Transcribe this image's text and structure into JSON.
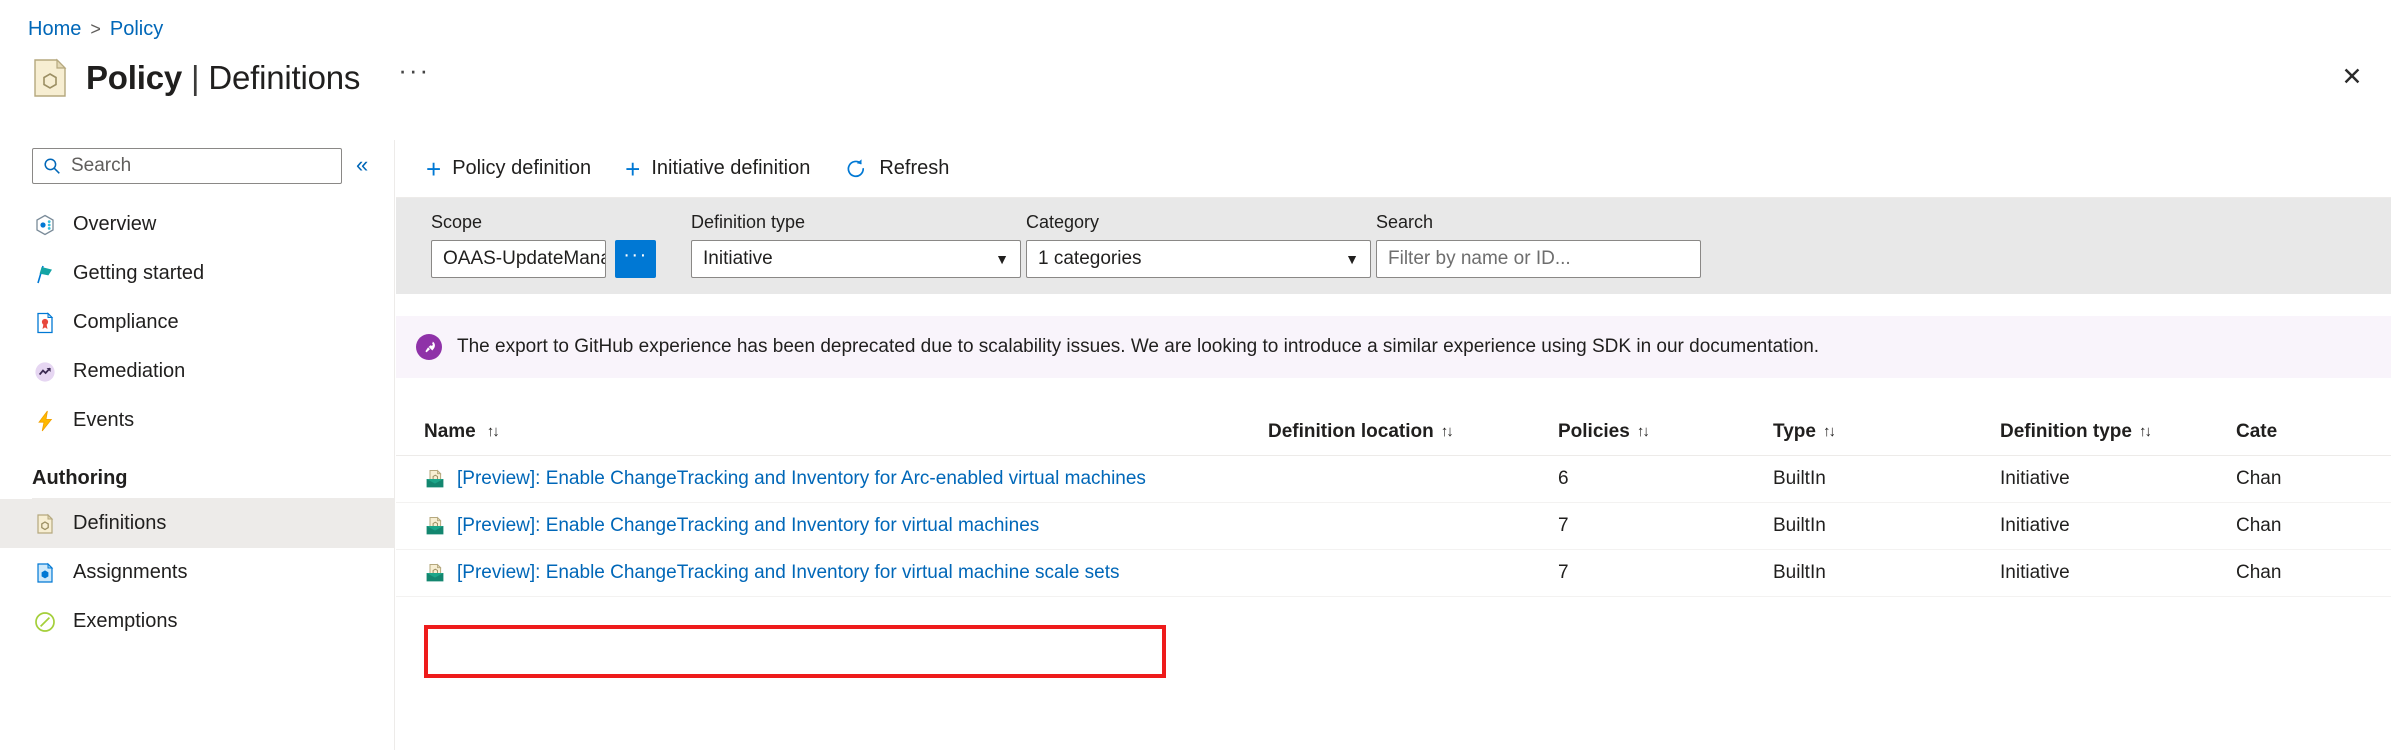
{
  "breadcrumb": {
    "home": "Home",
    "separator": ">",
    "current": "Policy"
  },
  "header": {
    "title_main": "Policy",
    "title_sep": "|",
    "title_sub": "Definitions",
    "more_label": "···",
    "close_label": "✕",
    "icon": "policy-definition-icon"
  },
  "sidebar": {
    "search_placeholder": "Search",
    "collapse_label": "«",
    "items": [
      {
        "label": "Overview",
        "icon": "overview-icon",
        "selected": false
      },
      {
        "label": "Getting started",
        "icon": "flag-icon",
        "selected": false
      },
      {
        "label": "Compliance",
        "icon": "compliance-icon",
        "selected": false
      },
      {
        "label": "Remediation",
        "icon": "remediation-icon",
        "selected": false
      },
      {
        "label": "Events",
        "icon": "lightning-icon",
        "selected": false
      }
    ],
    "group_label": "Authoring",
    "authoring_items": [
      {
        "label": "Definitions",
        "icon": "definitions-icon",
        "selected": true
      },
      {
        "label": "Assignments",
        "icon": "assignments-icon",
        "selected": false
      },
      {
        "label": "Exemptions",
        "icon": "exemptions-icon",
        "selected": false
      }
    ]
  },
  "toolbar": {
    "policy_definition": "Policy definition",
    "initiative_definition": "Initiative definition",
    "refresh": "Refresh"
  },
  "filters": {
    "scope": {
      "label": "Scope",
      "value": "OAAS-UpdateManagem...",
      "browse_label": "···"
    },
    "definition_type": {
      "label": "Definition type",
      "value": "Initiative"
    },
    "category": {
      "label": "Category",
      "value": "1 categories"
    },
    "search": {
      "label": "Search",
      "placeholder": "Filter by name or ID..."
    }
  },
  "notice": {
    "icon": "rocket-icon",
    "text": "The export to GitHub experience has been deprecated due to scalability issues. We are looking to introduce a similar experience using SDK in our documentation.",
    "accent": "#8f32a8",
    "background": "#f9f4fb"
  },
  "table": {
    "columns": [
      {
        "label": "Name",
        "sort": "↑↓"
      },
      {
        "label": "Definition location",
        "sort": "↑↓"
      },
      {
        "label": "Policies",
        "sort": "↑↓"
      },
      {
        "label": "Type",
        "sort": "↑↓"
      },
      {
        "label": "Definition type",
        "sort": "↑↓"
      },
      {
        "label": "Cate",
        "sort": ""
      }
    ],
    "rows": [
      {
        "name": "[Preview]: Enable ChangeTracking and Inventory for Arc-enabled virtual machines",
        "definition_location": "",
        "policies": "6",
        "type": "BuiltIn",
        "definition_type": "Initiative",
        "category": "Chan",
        "highlighted": false
      },
      {
        "name": "[Preview]: Enable ChangeTracking and Inventory for virtual machines",
        "definition_location": "",
        "policies": "7",
        "type": "BuiltIn",
        "definition_type": "Initiative",
        "category": "Chan",
        "highlighted": false
      },
      {
        "name": "[Preview]: Enable ChangeTracking and Inventory for virtual machine scale sets",
        "definition_location": "",
        "policies": "7",
        "type": "BuiltIn",
        "definition_type": "Initiative",
        "category": "Chan",
        "highlighted": true
      }
    ]
  },
  "annotation": {
    "color": "#ee1b1b"
  }
}
